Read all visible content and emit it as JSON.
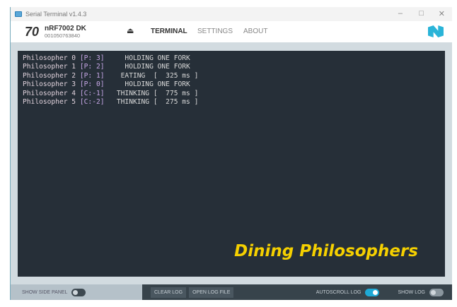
{
  "window": {
    "title": "Serial Terminal v1.4.3",
    "minimize": "–",
    "maximize": "□",
    "close": "✕"
  },
  "header": {
    "logo_text": "70",
    "device_name": "nRF7002 DK",
    "serial": "001050763840",
    "eject": "⏏",
    "tabs": [
      {
        "label": "TERMINAL",
        "active": true
      },
      {
        "label": "SETTINGS"
      },
      {
        "label": "ABOUT"
      }
    ]
  },
  "terminal": {
    "lines": [
      {
        "name": "Philosopher 0",
        "tag": "[P: 3]",
        "state": "    HOLDING ONE FORK"
      },
      {
        "name": "Philosopher 1",
        "tag": "[P: 2]",
        "state": "    HOLDING ONE FORK"
      },
      {
        "name": "Philosopher 2",
        "tag": "[P: 1]",
        "state": "   EATING  [  325 ms ]"
      },
      {
        "name": "Philosopher 3",
        "tag": "[P: 0]",
        "state": "    HOLDING ONE FORK"
      },
      {
        "name": "Philosopher 4",
        "tag": "[C:-1]",
        "state": "  THINKING [  775 ms ]"
      },
      {
        "name": "Philosopher 5",
        "tag": "[C:-2]",
        "state": "  THINKING [  275 ms ]"
      }
    ],
    "overlay_title": "Dining Philosophers"
  },
  "bottom": {
    "show_side_panel": "Show side panel",
    "side_panel_on": false,
    "clear_log": "Clear log",
    "open_log_file": "Open log file",
    "autoscroll_log": "Autoscroll log",
    "autoscroll_on": true,
    "show_log": "Show log",
    "show_log_on": false
  },
  "colors": {
    "accent": "#1ea9d6",
    "overlay": "#f5d000",
    "terminal_bg": "#262f38"
  }
}
